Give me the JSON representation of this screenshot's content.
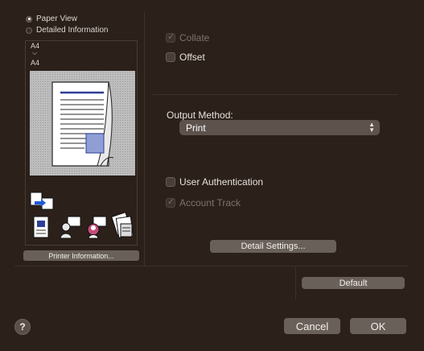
{
  "view_options": {
    "paper_view": "Paper View",
    "detailed_information": "Detailed Information",
    "selected": "paper_view"
  },
  "preview": {
    "original_size": "A4",
    "arrow": "⌵",
    "output_size": "A4"
  },
  "printer_information_button": "Printer Information...",
  "options": {
    "collate": {
      "label": "Collate",
      "checked": true,
      "enabled": false
    },
    "offset": {
      "label": "Offset",
      "checked": false,
      "enabled": true
    },
    "user_authentication": {
      "label": "User Authentication",
      "checked": false,
      "enabled": true
    },
    "account_track": {
      "label": "Account Track",
      "checked": true,
      "enabled": false
    }
  },
  "output_method": {
    "label": "Output Method:",
    "value": "Print"
  },
  "detail_settings_button": "Detail Settings...",
  "default_button": "Default",
  "cancel_button": "Cancel",
  "ok_button": "OK",
  "help_button": "?",
  "colors": {
    "background": "#2b201a",
    "button": "#6a605a",
    "select": "#5d524c"
  }
}
